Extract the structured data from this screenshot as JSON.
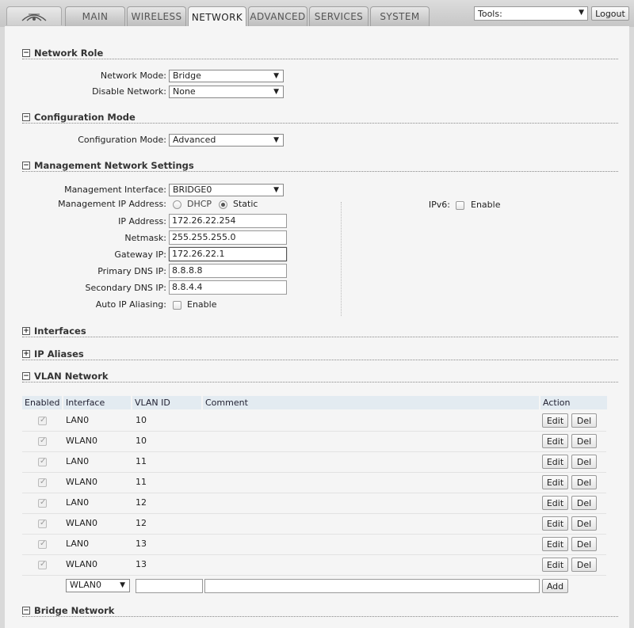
{
  "tabs": [
    "MAIN",
    "WIRELESS",
    "NETWORK",
    "ADVANCED",
    "SERVICES",
    "SYSTEM"
  ],
  "active_tab": "NETWORK",
  "tools": {
    "label": "Tools:",
    "logout": "Logout"
  },
  "sections": {
    "network_role": "Network Role",
    "configuration_mode": "Configuration Mode",
    "management": "Management Network Settings",
    "interfaces": "Interfaces",
    "ip_aliases": "IP Aliases",
    "vlan": "VLAN Network",
    "bridge": "Bridge Network"
  },
  "network_role": {
    "network_mode_label": "Network Mode:",
    "network_mode_value": "Bridge",
    "disable_network_label": "Disable Network:",
    "disable_network_value": "None"
  },
  "configuration_mode": {
    "label": "Configuration Mode:",
    "value": "Advanced"
  },
  "management": {
    "interface_label": "Management Interface:",
    "interface_value": "BRIDGE0",
    "ip_address_mode_label": "Management IP Address:",
    "dhcp_label": "DHCP",
    "static_label": "Static",
    "ip_address_label": "IP Address:",
    "ip_address": "172.26.22.254",
    "netmask_label": "Netmask:",
    "netmask": "255.255.255.0",
    "gateway_label": "Gateway IP:",
    "gateway": "172.26.22.1",
    "primary_dns_label": "Primary DNS IP:",
    "primary_dns": "8.8.8.8",
    "secondary_dns_label": "Secondary DNS IP:",
    "secondary_dns": "8.8.4.4",
    "auto_alias_label": "Auto IP Aliasing:",
    "enable_label": "Enable",
    "ipv6_label": "IPv6:"
  },
  "vlan": {
    "headers": {
      "enabled": "Enabled",
      "interface": "Interface",
      "vlan_id": "VLAN ID",
      "comment": "Comment",
      "action": "Action"
    },
    "rows": [
      {
        "interface": "LAN0",
        "vlan_id": "10"
      },
      {
        "interface": "WLAN0",
        "vlan_id": "10"
      },
      {
        "interface": "LAN0",
        "vlan_id": "11"
      },
      {
        "interface": "WLAN0",
        "vlan_id": "11"
      },
      {
        "interface": "LAN0",
        "vlan_id": "12"
      },
      {
        "interface": "WLAN0",
        "vlan_id": "12"
      },
      {
        "interface": "LAN0",
        "vlan_id": "13"
      },
      {
        "interface": "WLAN0",
        "vlan_id": "13"
      }
    ],
    "edit_label": "Edit",
    "del_label": "Del",
    "new_interface": "WLAN0",
    "add_label": "Add"
  }
}
